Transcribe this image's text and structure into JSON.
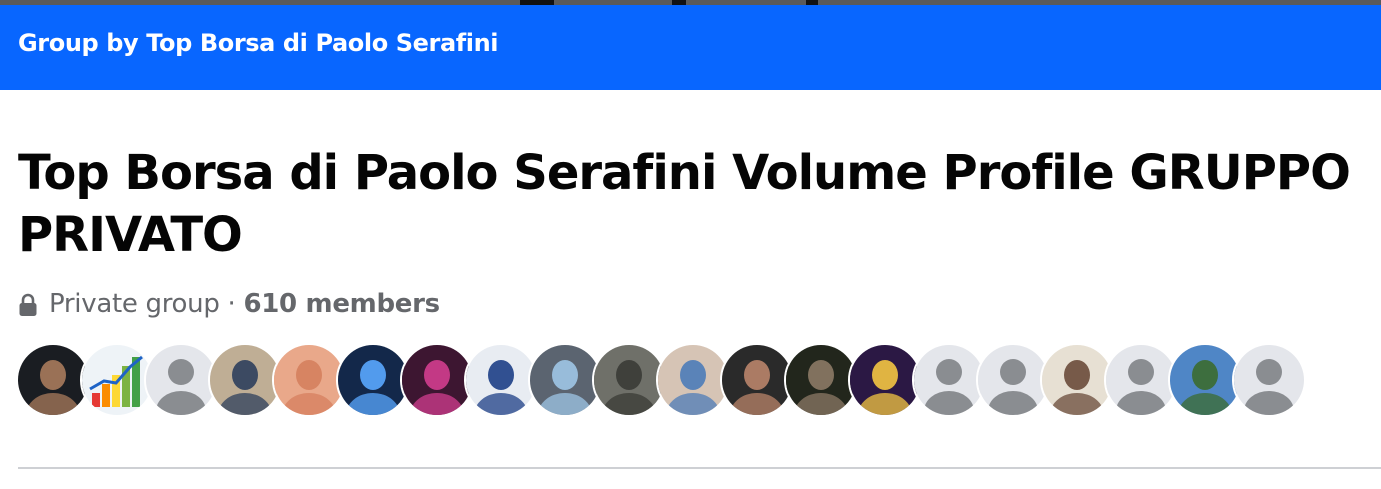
{
  "header": {
    "title": "Group by Top Borsa di Paolo Serafini",
    "color": "#0866ff"
  },
  "group": {
    "name": "Top Borsa di Paolo Serafini Volume Profile GRUPPO PRIVATO",
    "privacy_icon": "lock-icon",
    "privacy_label": "Private group",
    "separator": " · ",
    "member_count": "610 members"
  },
  "members_preview": {
    "avatar_count": 20,
    "avatars": [
      {
        "kind": "photo",
        "icon": "member-photo",
        "bg": "#1a1d22",
        "fg": "#a97b5c"
      },
      {
        "kind": "photo",
        "icon": "growth-chart-photo",
        "bg": "#eef3f7",
        "fg": "#43a047"
      },
      {
        "kind": "default",
        "icon": "default-avatar-icon",
        "bg": "#e4e6eb",
        "fg": "#8a8d91"
      },
      {
        "kind": "photo",
        "icon": "member-photo",
        "bg": "#bfae95",
        "fg": "#2e3f5c"
      },
      {
        "kind": "photo",
        "icon": "member-photo",
        "bg": "#e9a88a",
        "fg": "#d57f5d"
      },
      {
        "kind": "photo",
        "icon": "member-photo",
        "bg": "#13284a",
        "fg": "#5aa7ff"
      },
      {
        "kind": "photo",
        "icon": "member-photo",
        "bg": "#3d1631",
        "fg": "#d23d8f"
      },
      {
        "kind": "photo",
        "icon": "member-photo",
        "bg": "#e8ecf2",
        "fg": "#1d3f86"
      },
      {
        "kind": "photo",
        "icon": "member-photo",
        "bg": "#5b6470",
        "fg": "#9ec5e6"
      },
      {
        "kind": "photo",
        "icon": "member-photo",
        "bg": "#6f7069",
        "fg": "#3a3b36"
      },
      {
        "kind": "photo",
        "icon": "member-photo",
        "bg": "#d6c4b5",
        "fg": "#4d7cb8"
      },
      {
        "kind": "photo",
        "icon": "member-photo",
        "bg": "#2a2a2a",
        "fg": "#b9846a"
      },
      {
        "kind": "photo",
        "icon": "member-photo",
        "bg": "#22261c",
        "fg": "#8c7a66"
      },
      {
        "kind": "photo",
        "icon": "member-photo",
        "bg": "#2b1844",
        "fg": "#f4c542"
      },
      {
        "kind": "default",
        "icon": "default-avatar-icon",
        "bg": "#e4e6eb",
        "fg": "#8a8d91"
      },
      {
        "kind": "default",
        "icon": "default-avatar-icon",
        "bg": "#e4e6eb",
        "fg": "#8a8d91"
      },
      {
        "kind": "photo",
        "icon": "member-photo",
        "bg": "#e7e0d3",
        "fg": "#6a4b3a"
      },
      {
        "kind": "default",
        "icon": "default-avatar-icon",
        "bg": "#e4e6eb",
        "fg": "#8a8d91"
      },
      {
        "kind": "photo",
        "icon": "member-photo",
        "bg": "#4f86c6",
        "fg": "#3b6b2f"
      },
      {
        "kind": "default",
        "icon": "default-avatar-icon",
        "bg": "#e4e6eb",
        "fg": "#8a8d91"
      }
    ]
  }
}
